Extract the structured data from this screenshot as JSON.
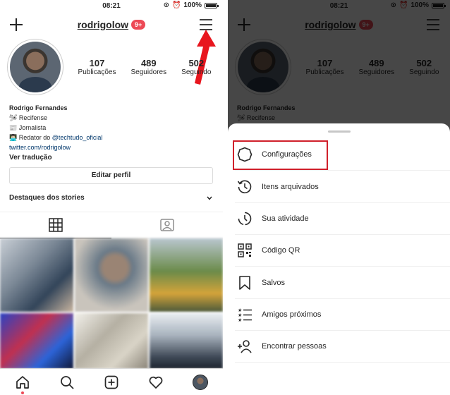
{
  "status_bar": {
    "time": "08:21",
    "battery": "100%"
  },
  "profile": {
    "username": "rodrigolow",
    "notifications_badge": "9+",
    "stats": [
      {
        "value": "107",
        "label": "Publicações"
      },
      {
        "value": "489",
        "label": "Seguidores"
      },
      {
        "value": "502",
        "label": "Seguindo"
      }
    ],
    "bio": {
      "name": "Rodrigo Fernandes",
      "line1": "🛩 Recifense",
      "line2": "📰 Jornalista",
      "line3_prefix": "👨🏻‍💻 Redator do ",
      "line3_mention": "@techtudo_oficial",
      "link": "twitter.com/rodrigolow",
      "translate": "Ver tradução"
    },
    "edit_profile": "Editar perfil",
    "highlights_label": "Destaques dos stories"
  },
  "settings_menu": {
    "items": [
      {
        "label": "Configurações",
        "icon": "gear-icon"
      },
      {
        "label": "Itens arquivados",
        "icon": "archive-history-icon"
      },
      {
        "label": "Sua atividade",
        "icon": "activity-clock-icon"
      },
      {
        "label": "Código QR",
        "icon": "qr-code-icon"
      },
      {
        "label": "Salvos",
        "icon": "bookmark-icon"
      },
      {
        "label": "Amigos próximos",
        "icon": "close-friends-list-icon"
      },
      {
        "label": "Encontrar pessoas",
        "icon": "add-person-icon"
      }
    ]
  },
  "colors": {
    "accent_red": "#ed4956",
    "annotation_red": "#d0202b",
    "link_blue": "#00376b"
  }
}
